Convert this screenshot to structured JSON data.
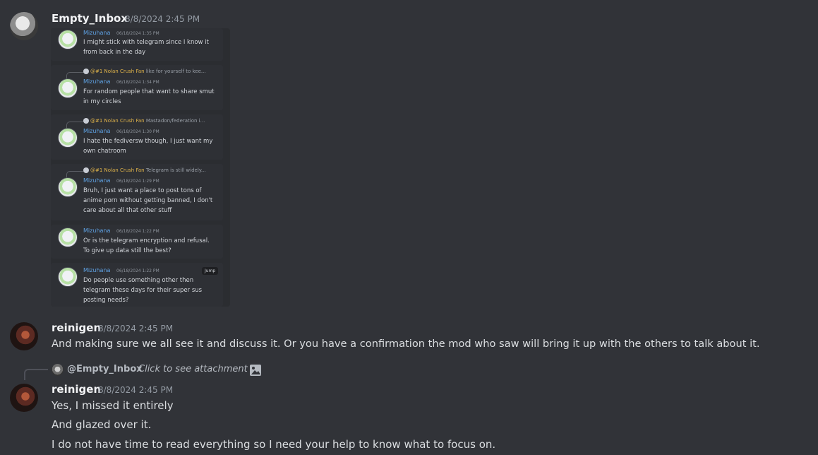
{
  "messages": [
    {
      "user": "Empty_Inbox",
      "time": "8/8/2024 2:45 PM"
    },
    {
      "user": "reinigen",
      "time": "8/8/2024 2:45 PM",
      "text": "And making sure we all see it and discuss it. Or you have a confirmation the mod who saw will bring it up with the others to talk about it."
    },
    {
      "user": "reinigen",
      "time": "8/8/2024 2:45 PM",
      "lines": [
        "Yes, I missed it entirely",
        "And glazed over it.",
        "I do not have time to read everything so I need your help to know what to focus on."
      ]
    }
  ],
  "reply": {
    "mention": "@Empty_Inbox",
    "hint": "Click to see attachment"
  },
  "attachment": {
    "cards": [
      {
        "name": "Mizuhana",
        "time": "06/18/2024 1:35 PM",
        "text": "I might stick with telegram since I know it from back in the day"
      },
      {
        "ref_tag": "@#1 Nolan Crush Fan",
        "ref_text": "like for yourself to kee...",
        "name": "Mizuhana",
        "time": "06/18/2024 1:34 PM",
        "text": "For random people that want to share smut in my circles"
      },
      {
        "ref_tag": "@#1 Nolan Crush Fan",
        "ref_text": "Mastadon/federation i...",
        "name": "Mizuhana",
        "time": "06/18/2024 1:30 PM",
        "text": "I hate the fediversw though, I just want my own chatroom"
      },
      {
        "ref_tag": "@#1 Nolan Crush Fan",
        "ref_text": "Telegram is still widely...",
        "name": "Mizuhana",
        "time": "06/18/2024 1:29 PM",
        "text": "Bruh, I just want a place to post tons of anime porn without getting banned, I don't care about all that other stuff"
      },
      {
        "name": "Mizuhana",
        "time": "06/18/2024 1:22 PM",
        "text": "Or is the telegram encryption and refusal. To give up data still the best?"
      },
      {
        "name": "Mizuhana",
        "time": "06/18/2024 1:22 PM",
        "text": "Do people use something other then telegram these days for their super sus posting needs?",
        "jump": "Jump"
      }
    ]
  },
  "colors": {
    "background": "#313338",
    "username": "#f2f3f5",
    "timestamp": "#949ba4",
    "mini_name": "#5fa3e6",
    "ref_tag": "#e0b44a"
  }
}
